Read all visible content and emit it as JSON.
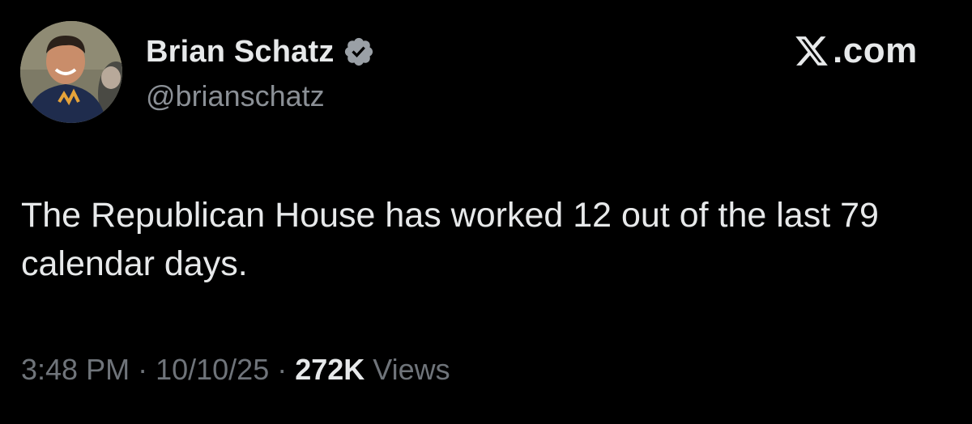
{
  "author": {
    "display_name": "Brian Schatz",
    "handle": "@brianschatz",
    "verified": true
  },
  "brand": {
    "logo_letter": "X",
    "logo_rest": ".com"
  },
  "tweet": {
    "text": "The Republican House has worked 12 out of the last 79 calendar days."
  },
  "meta": {
    "time": "3:48 PM",
    "separator": "·",
    "date": "10/10/25",
    "views_count": "272K",
    "views_label": "Views"
  },
  "colors": {
    "background": "#000000",
    "primary_text": "#e7e9ea",
    "secondary_text": "#8b9096",
    "verified_badge": "#9aa0a6"
  },
  "icons": {
    "verified": "verified-badge-icon",
    "brand": "x-logo-icon"
  }
}
